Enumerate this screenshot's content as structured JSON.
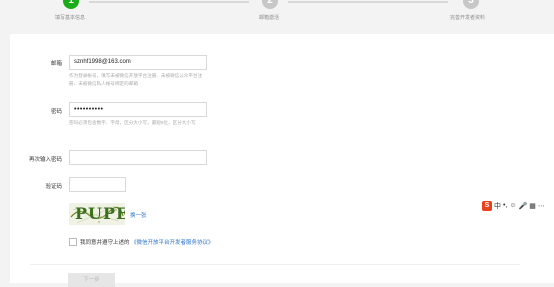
{
  "steps": [
    {
      "number": "1",
      "label": "填写基本信息",
      "state": "done"
    },
    {
      "number": "2",
      "label": "邮箱激活",
      "state": "todo"
    },
    {
      "number": "3",
      "label": "完善开发者资料",
      "state": "todo"
    }
  ],
  "form": {
    "email": {
      "label": "邮箱",
      "value": "sznhf1998@163.com",
      "hint": "作为登录帐号，填写未被微信开放平台注册、未被微信公众平台注册、未被微信私人帐号绑定的邮箱"
    },
    "password": {
      "label": "密码",
      "value": "••••••••••",
      "hint": "密码必须包含数字、字母，区分大小写，最短8位，区分大小写"
    },
    "confirm_password": {
      "label": "再次输入密码",
      "value": ""
    },
    "captcha": {
      "label": "验证码",
      "value": "",
      "image_text": "PUPE",
      "refresh_label": "换一张"
    },
    "agreement": {
      "prefix": "我同意并遵守上述的",
      "link": "《微信开放平台开发者服务协议》",
      "checked": false
    },
    "next_label": "下一步"
  },
  "ime_toolbar": {
    "logo": "S",
    "items": [
      "中",
      "•,",
      "☺",
      "🎤",
      "▦",
      "⋯"
    ]
  },
  "colors": {
    "accent_green": "#1aad19",
    "link_blue": "#2a73c5",
    "step_inactive": "#c7c7c7"
  }
}
